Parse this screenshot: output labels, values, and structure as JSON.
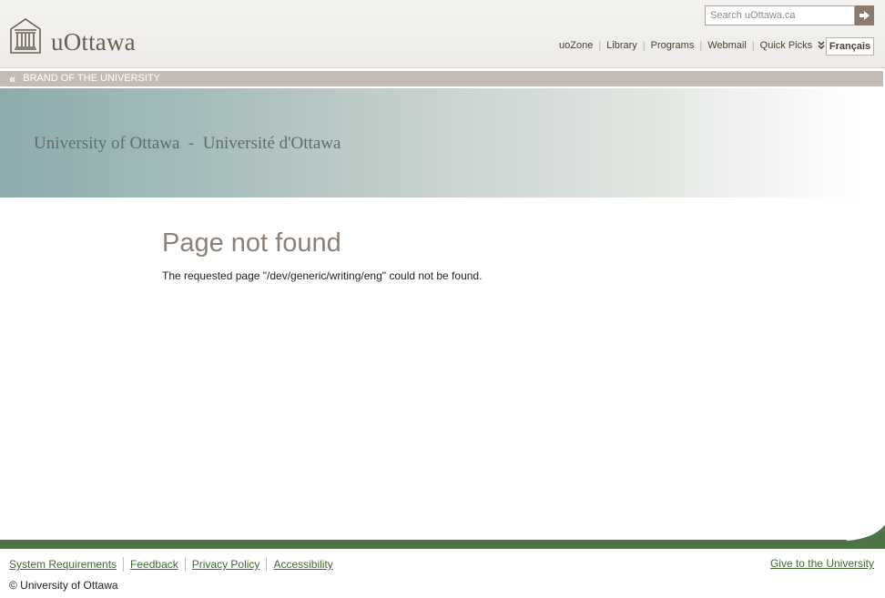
{
  "header": {
    "logo_text": "uOttawa",
    "search": {
      "placeholder": "Search uOttawa.ca"
    },
    "nav": [
      "uoZone",
      "Library",
      "Programs",
      "Webmail",
      "Quick Picks"
    ],
    "language_button": "Français"
  },
  "brand_bar": {
    "arrows": "«",
    "label": "BRAND OF THE UNIVERSITY"
  },
  "banner": {
    "title": "University of Ottawa  -  Université d'Ottawa"
  },
  "main": {
    "heading": "Page not found",
    "message": "The requested page \"/dev/generic/writing/eng\" could not be found."
  },
  "footer": {
    "links": [
      "System Requirements",
      "Feedback",
      "Privacy Policy",
      "Accessibility"
    ],
    "give_link": "Give to the University",
    "copyright": "© University of Ottawa"
  },
  "colors": {
    "brand_brown": "#6b5e52",
    "footer_green": "#4e7345",
    "link_green": "#3d6b2f",
    "brand_bar": "#c4bcb5"
  },
  "icons": {
    "logo": "university-building-icon",
    "search_submit": "arrow-right-icon",
    "quick_picks": "double-chevron-down-icon"
  }
}
